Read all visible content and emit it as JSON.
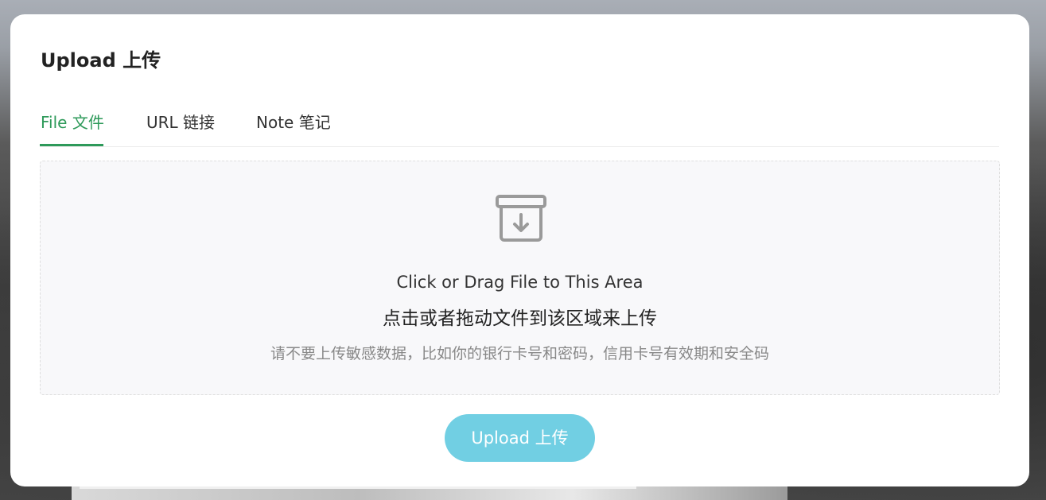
{
  "dialog": {
    "title": "Upload 上传"
  },
  "tabs": [
    {
      "label": "File 文件",
      "active": true
    },
    {
      "label": "URL 链接",
      "active": false
    },
    {
      "label": "Note 笔记",
      "active": false
    }
  ],
  "dropzone": {
    "icon": "archive-download-icon",
    "line1": "Click or Drag File to This Area",
    "line2": "点击或者拖动文件到该区域来上传",
    "hint": "请不要上传敏感数据，比如你的银行卡号和密码，信用卡号有效期和安全码"
  },
  "upload_button": {
    "label": "Upload 上传"
  },
  "colors": {
    "accent": "#2e9a5a",
    "button": "#71cfe3",
    "dropzone_bg": "#f8f8fa"
  }
}
